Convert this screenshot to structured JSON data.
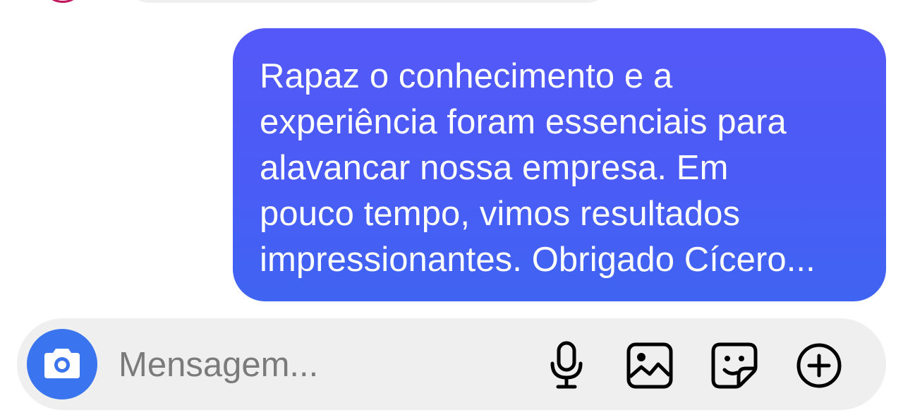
{
  "message": {
    "text": "Rapaz o conhecimento e a\nexperiência foram essenciais para\nalavancar nossa empresa. Em\npouco tempo, vimos resultados\nimpressionantes. Obrigado Cícero..."
  },
  "composer": {
    "placeholder": "Mensagem...",
    "camera_icon": "camera-icon",
    "mic_icon": "microphone-icon",
    "gallery_icon": "image-icon",
    "sticker_icon": "sticker-icon",
    "more_icon": "plus-circle-icon"
  },
  "colors": {
    "bubble_start": "#5458f8",
    "bubble_end": "#3f64f2",
    "camera_button": "#3a74ef",
    "composer_background": "#efefef"
  }
}
